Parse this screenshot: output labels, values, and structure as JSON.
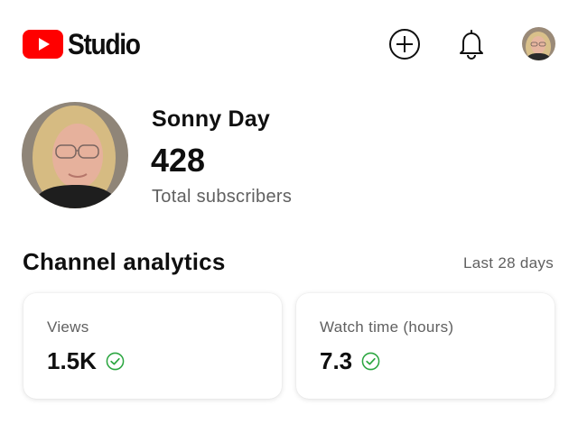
{
  "header": {
    "logo_text": "Studio",
    "brand_color": "#ff0000",
    "icons": [
      "youtube-play-icon",
      "create-plus-icon",
      "bell-icon",
      "account-avatar"
    ]
  },
  "channel": {
    "name": "Sonny Day",
    "subscribers": "428",
    "subscribers_label": "Total subscribers"
  },
  "analytics": {
    "title": "Channel analytics",
    "period": "Last 28 days",
    "cards": [
      {
        "label": "Views",
        "value": "1.5K",
        "status_icon": "check-circle-icon",
        "status_color": "#2ba640"
      },
      {
        "label": "Watch time (hours)",
        "value": "7.3",
        "status_icon": "check-circle-icon",
        "status_color": "#2ba640"
      }
    ]
  }
}
